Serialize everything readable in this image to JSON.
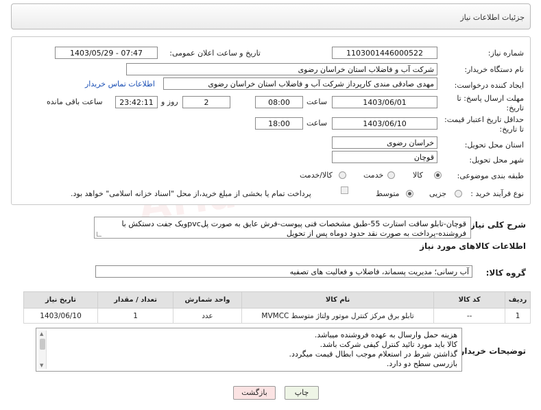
{
  "header": {
    "title": "جزئیات اطلاعات نیاز"
  },
  "form": {
    "need_number": {
      "label": "شماره نیاز:",
      "value": "1103001446000522"
    },
    "announce_datetime": {
      "label": "تاریخ و ساعت اعلان عمومی:",
      "value": "1403/05/29 - 07:47"
    },
    "buyer_org": {
      "label": "نام دستگاه خریدار:",
      "value": "شرکت آب و فاضلاب استان خراسان رضوی"
    },
    "requester": {
      "label": "ایجاد کننده درخواست:",
      "value": "مهدی صادقی مندی کارپرداز شرکت آب و فاضلاب استان خراسان رضوی",
      "contact_link": "اطلاعات تماس خریدار"
    },
    "reply_deadline": {
      "label": "مهلت ارسال پاسخ: تا تاریخ:",
      "date": "1403/06/01",
      "time_label": "ساعت",
      "time": "08:00",
      "days": "2",
      "days_label": "روز و",
      "remaining": "23:42:11",
      "remaining_label": "ساعت باقی مانده"
    },
    "price_validity": {
      "label": "حداقل تاریخ اعتبار قیمت: تا تاریخ:",
      "date": "1403/06/10",
      "time_label": "ساعت",
      "time": "18:00"
    },
    "delivery_province": {
      "label": "استان محل تحویل:",
      "value": "خراسان رضوی"
    },
    "delivery_city": {
      "label": "شهر محل تحویل:",
      "value": "قوچان"
    },
    "category": {
      "label": "طبقه بندی موضوعی:",
      "options": [
        "کالا",
        "خدمت",
        "کالا/خدمت"
      ],
      "selected": "کالا"
    },
    "purchase_process": {
      "label": "نوع فرآیند خرید :",
      "options": [
        "جزیی",
        "متوسط"
      ],
      "selected": "متوسط",
      "checkbox_label": "پرداخت تمام یا بخشی از مبلغ خرید،از محل \"اسناد خزانه اسلامی\" خواهد بود."
    }
  },
  "description": {
    "label": "شرح کلی نیاز:",
    "text": "قوچان-تابلو سافت استارت 55-طبق مشخصات فنی پیوست-فرش عایق به صورت پلpvcویک جفت دستکش با فروشنده-پرداخت به صورت نقد حدود دوماه پس از تحویل"
  },
  "goods_info": {
    "title": "اطلاعات کالاهای مورد نیاز",
    "group_label": "گروه کالا:",
    "group_value": "آب رسانی؛ مدیریت پسماند، فاضلاب و فعالیت های تصفیه"
  },
  "table": {
    "headers": [
      "ردیف",
      "کد کالا",
      "نام کالا",
      "واحد شمارش",
      "تعداد / مقدار",
      "تاریخ نیاز"
    ],
    "rows": [
      [
        "1",
        "--",
        "تابلو برق مرکز کنترل موتور ولتاژ متوسط MVMCC",
        "عدد",
        "1",
        "1403/06/10"
      ]
    ]
  },
  "buyer_notes": {
    "label": "توضیحات خریدار:",
    "lines": [
      "هزینه حمل وارسال به عهده فروشنده میباشد.",
      "کالا باید مورد تائید کنترل کیفی شرکت باشد.",
      "گذاشتن شرط در استعلام موجب ابطال قیمت میگردد.",
      "بازرسی سطح دو دارد."
    ]
  },
  "buttons": {
    "print": "چاپ",
    "back": "بازگشت"
  },
  "watermark": "AriaTender.net",
  "colors": {
    "link": "#1a4fb5",
    "back_button_bg": "#fbe3e3",
    "print_button_bg": "#eef5e6",
    "table_header_bg": "#e2e2e2"
  }
}
